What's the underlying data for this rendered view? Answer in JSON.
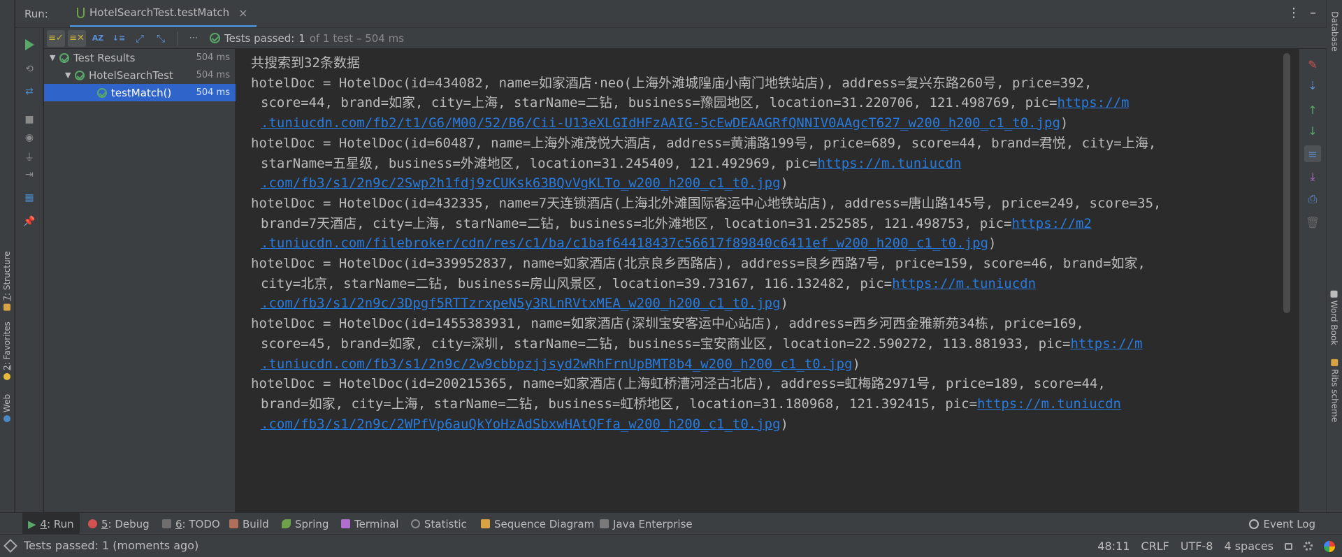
{
  "left_stripe": {
    "tabs": [
      {
        "num": "7",
        "label": ": Structure"
      },
      {
        "num": "2",
        "label": ": Favorites"
      },
      {
        "num": "",
        "label": "Web"
      }
    ]
  },
  "right_stripe": {
    "tabs": [
      "Database",
      "Word Book",
      "Ribs scheme"
    ]
  },
  "run_header": {
    "label": "Run:",
    "tab_title": "HotelSearchTest.testMatch",
    "close_glyph": "×"
  },
  "test_toolbar": {
    "status_prefix": "Tests passed:",
    "passed_count": "1",
    "status_suffix": "of 1 test – 504 ms"
  },
  "test_tree": {
    "rows": [
      {
        "label": "Test Results",
        "time": "504 ms"
      },
      {
        "label": "HotelSearchTest",
        "time": "504 ms"
      },
      {
        "label": "testMatch()",
        "time": "504 ms"
      }
    ]
  },
  "console": {
    "lines": [
      {
        "text": "共搜索到32条数据"
      },
      {
        "text": "hotelDoc = HotelDoc(id=434082, name=如家酒店·neo(上海外滩城隍庙小南门地铁站店), address=复兴东路260号, price=392,"
      },
      {
        "text": "score=44, brand=如家, city=上海, starName=二钻, business=豫园地区, location=31.220706, 121.498769, pic=",
        "link": "https://m"
      },
      {
        "text": "",
        "link": ".tuniucdn.com/fb2/t1/G6/M00/52/B6/Cii-U13eXLGIdHFzAAIG-5cEwDEAAGRfQNNIV0AAgcT627_w200_h200_c1_t0.jpg",
        "tail": ")"
      },
      {
        "text": "hotelDoc = HotelDoc(id=60487, name=上海外滩茂悦大酒店, address=黄浦路199号, price=689, score=44, brand=君悦, city=上海,"
      },
      {
        "text": " starName=五星级, business=外滩地区, location=31.245409, 121.492969, pic=",
        "link": "https://m.tuniucdn"
      },
      {
        "text": "",
        "link": ".com/fb3/s1/2n9c/2Swp2h1fdj9zCUKsk63BQvVgKLTo_w200_h200_c1_t0.jpg",
        "tail": ")"
      },
      {
        "text": "hotelDoc = HotelDoc(id=432335, name=7天连锁酒店(上海北外滩国际客运中心地铁站店), address=唐山路145号, price=249, score=35,"
      },
      {
        "text": " brand=7天酒店, city=上海, starName=二钻, business=北外滩地区, location=31.252585, 121.498753, pic=",
        "link": "https://m2"
      },
      {
        "text": "",
        "link": ".tuniucdn.com/filebroker/cdn/res/c1/ba/c1baf64418437c56617f89840c6411ef_w200_h200_c1_t0.jpg",
        "tail": ")"
      },
      {
        "text": "hotelDoc = HotelDoc(id=339952837, name=如家酒店(北京良乡西路店), address=良乡西路7号, price=159, score=46, brand=如家,"
      },
      {
        "text": "city=北京, starName=二钻, business=房山风景区, location=39.73167, 116.132482, pic=",
        "link": "https://m.tuniucdn"
      },
      {
        "text": "",
        "link": ".com/fb3/s1/2n9c/3Dpgf5RTTzrxpeN5y3RLnRVtxMEA_w200_h200_c1_t0.jpg",
        "tail": ")"
      },
      {
        "text": "hotelDoc = HotelDoc(id=1455383931, name=如家酒店(深圳宝安客运中心站店), address=西乡河西金雅新苑34栋, price=169,"
      },
      {
        "text": "score=45, brand=如家, city=深圳, starName=二钻, business=宝安商业区, location=22.590272, 113.881933, pic=",
        "link": "https://m"
      },
      {
        "text": "",
        "link": ".tuniucdn.com/fb3/s1/2n9c/2w9cbbpzjjsyd2wRhFrnUpBMT8b4_w200_h200_c1_t0.jpg",
        "tail": ")"
      },
      {
        "text": "hotelDoc = HotelDoc(id=200215365, name=如家酒店(上海虹桥漕河泾古北店), address=虹梅路2971号, price=189, score=44,"
      },
      {
        "text": "brand=如家, city=上海, starName=二钻, business=虹桥地区, location=31.180968, 121.392415, pic=",
        "link": "https://m.tuniucdn"
      },
      {
        "text": "",
        "link": ".com/fb3/s1/2n9c/2WPfVp6auQkYoHzAdSbxwHAtQFfa_w200_h200_c1_t0.jpg",
        "tail": ")"
      }
    ]
  },
  "bottom_tabs": [
    {
      "num": "4",
      "label": ": Run"
    },
    {
      "num": "5",
      "label": ": Debug"
    },
    {
      "num": "6",
      "label": ": TODO"
    },
    {
      "num": "",
      "label": "Build"
    },
    {
      "num": "",
      "label": "Spring"
    },
    {
      "num": "",
      "label": "Terminal"
    },
    {
      "num": "",
      "label": "Statistic"
    },
    {
      "num": "",
      "label": "Sequence Diagram"
    },
    {
      "num": "",
      "label": "Java Enterprise"
    }
  ],
  "event_log": "Event Log",
  "statusbar": {
    "message": "Tests passed: 1 (moments ago)",
    "position": "48:11",
    "line_sep": "CRLF",
    "encoding": "UTF-8",
    "indent": "4 spaces"
  },
  "colors": {
    "pass_green": "#59a869",
    "link_blue": "#287bde",
    "selection": "#2f65ca"
  }
}
